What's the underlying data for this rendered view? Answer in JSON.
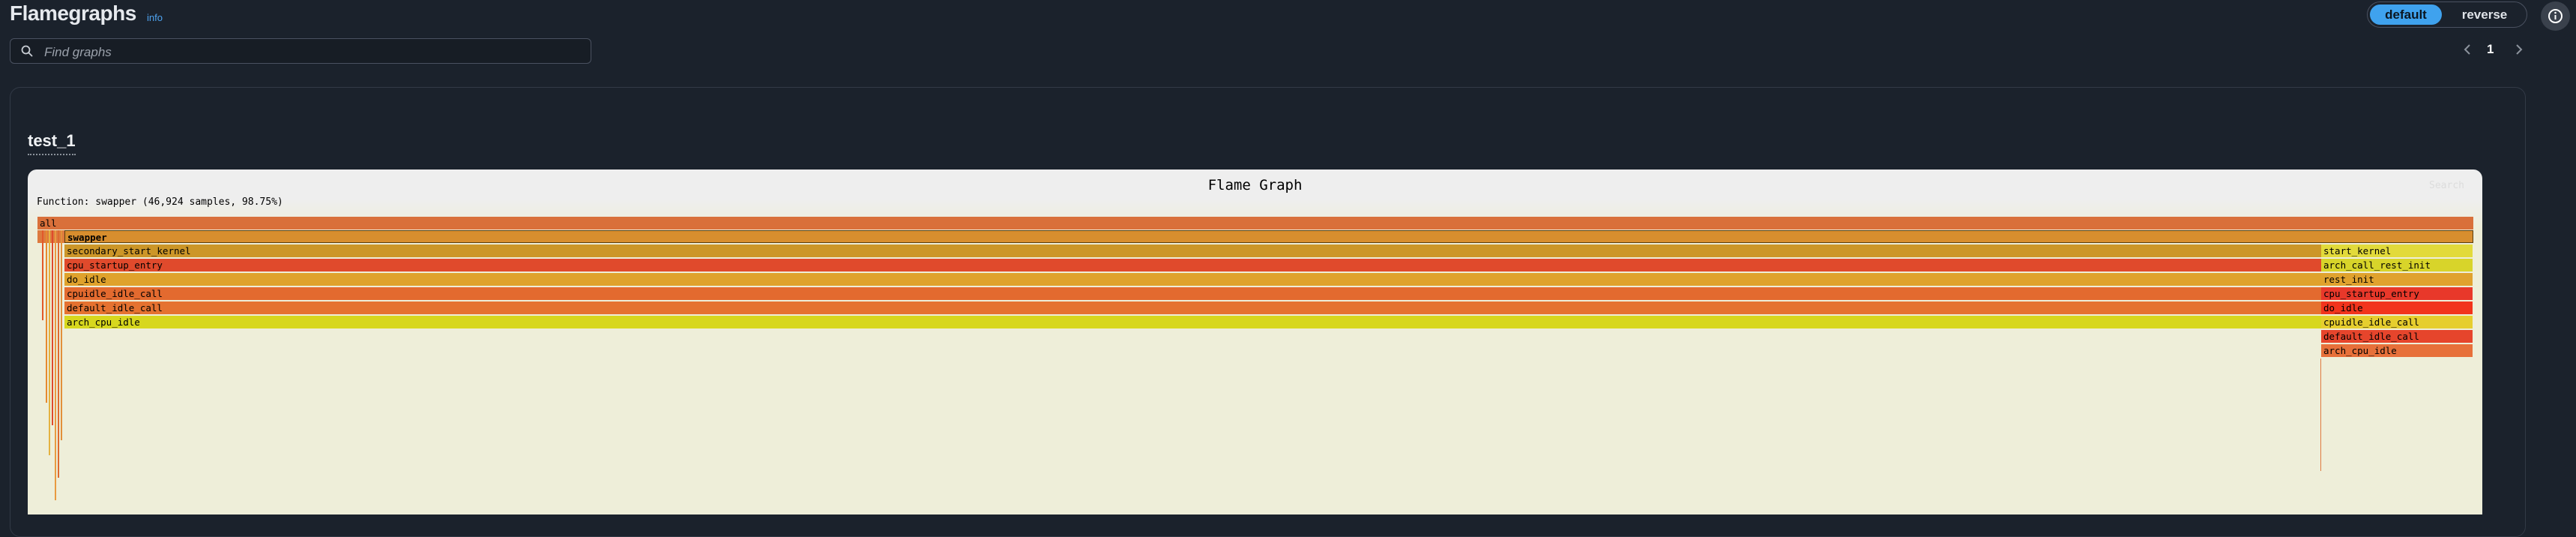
{
  "header": {
    "title": "Flamegraphs",
    "info_link": "info"
  },
  "search": {
    "placeholder": "Find graphs"
  },
  "view_toggle": {
    "options": [
      "default",
      "reverse"
    ],
    "selected": "default"
  },
  "pagination": {
    "current_page": "1"
  },
  "graph": {
    "name": "test_1",
    "title": "Flame Graph",
    "search_label": "Search",
    "details": "Function: swapper (46,924 samples, 98.75%)",
    "frames": {
      "all": "all",
      "swapper": "swapper",
      "left_stack": [
        "secondary_start_kernel",
        "cpu_startup_entry",
        "do_idle",
        "cpuidle_idle_call",
        "default_idle_call",
        "arch_cpu_idle"
      ],
      "right_stack": [
        "start_kernel",
        "arch_call_rest_init",
        "rest_init",
        "cpu_startup_entry",
        "do_idle",
        "cpuidle_idle_call",
        "default_idle_call",
        "arch_cpu_idle"
      ]
    }
  },
  "colors": {
    "accent": "#3fa2ee",
    "background": "#1b222c",
    "frame_all": "#d9703a",
    "frame_swapper": "#d88e2e"
  }
}
